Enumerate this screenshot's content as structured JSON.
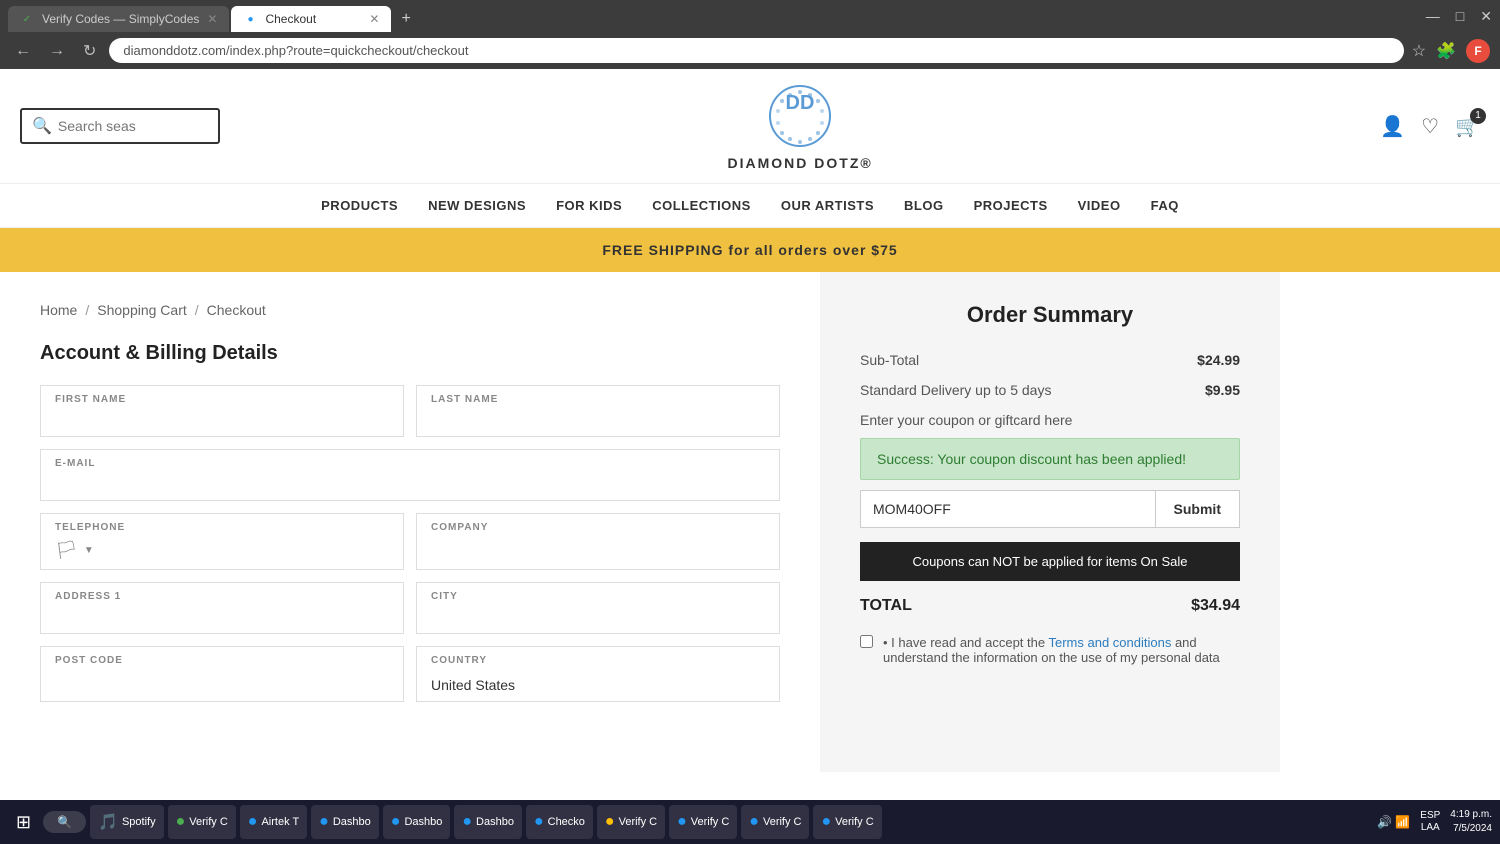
{
  "browser": {
    "tabs": [
      {
        "id": "tab-1",
        "label": "Verify Codes — SimplyCodes",
        "active": false,
        "favicon": "✓"
      },
      {
        "id": "tab-2",
        "label": "Checkout",
        "active": true,
        "favicon": "🔵"
      }
    ],
    "url": "diamonddotz.com/index.php?route=quickcheckout/checkout",
    "new_tab_label": "+",
    "window_controls": [
      "—",
      "□",
      "✕"
    ]
  },
  "header": {
    "search_placeholder": "Search seas",
    "logo_brand": "DIAMOND DOTZ®",
    "nav_items": [
      "PRODUCTS",
      "NEW DESIGNS",
      "FOR KIDS",
      "COLLECTIONS",
      "OUR ARTISTS",
      "BLOG",
      "PROJECTS",
      "VIDEO",
      "FAQ"
    ],
    "promo": "FREE SHIPPING for all orders over $75",
    "cart_count": "1"
  },
  "breadcrumb": {
    "items": [
      "Home",
      "Shopping Cart",
      "Checkout"
    ],
    "separators": [
      "/",
      "/"
    ]
  },
  "form": {
    "section_title": "Account & Billing Details",
    "fields": {
      "first_name": {
        "label": "FIRST NAME",
        "value": ""
      },
      "last_name": {
        "label": "LAST NAME",
        "value": ""
      },
      "email": {
        "label": "E-MAIL",
        "value": ""
      },
      "telephone": {
        "label": "TELEPHONE",
        "flag": "🏳",
        "dropdown": "▼"
      },
      "company": {
        "label": "COMPANY",
        "value": ""
      },
      "address1": {
        "label": "ADDRESS 1",
        "value": ""
      },
      "city": {
        "label": "CITY",
        "value": ""
      },
      "post_code": {
        "label": "POST CODE",
        "value": ""
      },
      "country": {
        "label": "COUNTRY",
        "value": "United States"
      }
    }
  },
  "order_summary": {
    "title": "Order Summary",
    "subtotal_label": "Sub-Total",
    "subtotal_value": "$24.99",
    "delivery_label": "Standard Delivery up to 5 days",
    "delivery_value": "$9.95",
    "coupon_prompt": "Enter your coupon or giftcard here",
    "success_message": "Success: Your coupon discount has been applied!",
    "coupon_code": "MOM40OFF",
    "submit_label": "Submit",
    "notice": "Coupons can NOT be applied for items On Sale",
    "total_label": "TOTAL",
    "total_value": "$34.94",
    "terms_prefix": "• I have read and accept the ",
    "terms_link": "Terms and conditions",
    "terms_suffix": " and understand the information on the use of my personal data"
  },
  "taskbar": {
    "start_icon": "⊞",
    "search_placeholder": "🔍",
    "apps": [
      {
        "label": "Spotify",
        "icon": "🎵"
      },
      {
        "label": "Verify C",
        "icon": "🟢"
      },
      {
        "label": "Airtek T",
        "icon": "🔵"
      },
      {
        "label": "Dashbo",
        "icon": "🔵"
      },
      {
        "label": "Dashbo",
        "icon": "🔵"
      },
      {
        "label": "Dashbo",
        "icon": "🔵"
      },
      {
        "label": "Checkо",
        "icon": "🔵"
      },
      {
        "label": "Verify C",
        "icon": "🟡"
      },
      {
        "label": "Verify C",
        "icon": "🔵"
      },
      {
        "label": "Verify C",
        "icon": "🔵"
      },
      {
        "label": "Verify C",
        "icon": "🔵"
      }
    ],
    "lang": "ESP\nLAA",
    "time": "4:19 p.m.",
    "date": "7/5/2024"
  },
  "colors": {
    "promo_bg": "#f0c040",
    "success_bg": "#c8e6c9",
    "success_text": "#2e7d32",
    "notice_bg": "#222222",
    "link_color": "#2c7cbf",
    "accent": "#333333"
  }
}
